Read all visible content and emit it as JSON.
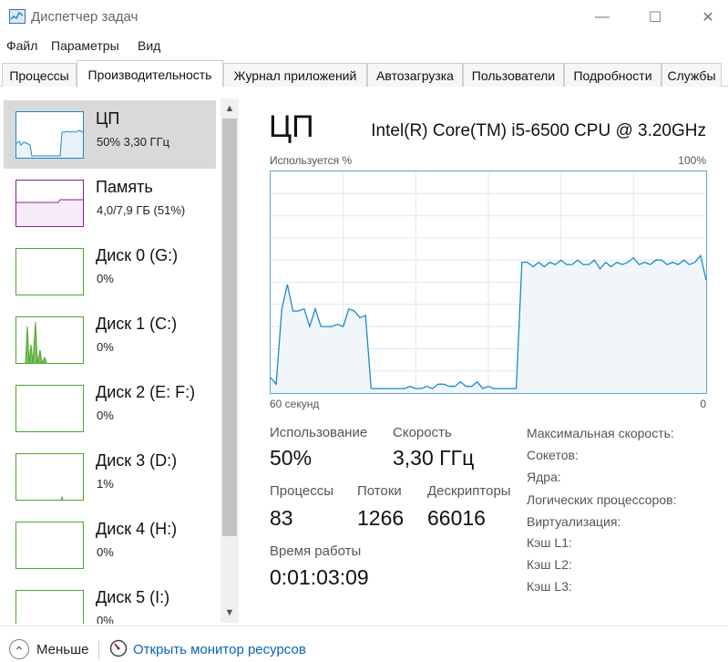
{
  "window": {
    "title": "Диспетчер задач",
    "minimize_glyph": "—",
    "maximize_glyph": "☐",
    "close_glyph": "✕"
  },
  "menu": [
    "Файл",
    "Параметры",
    "Вид"
  ],
  "tabs": [
    "Процессы",
    "Производительность",
    "Журнал приложений",
    "Автозагрузка",
    "Пользователи",
    "Подробности",
    "Службы"
  ],
  "active_tab": "Производительность",
  "sidebar": {
    "items": [
      {
        "title": "ЦП",
        "subtitle": "50% 3,30 ГГц",
        "color": "#1b8ac7"
      },
      {
        "title": "Память",
        "subtitle": "4,0/7,9 ГБ (51%)",
        "color": "#8b1f9c"
      },
      {
        "title": "Диск 0 (G:)",
        "subtitle": "0%",
        "color": "#4ca72f"
      },
      {
        "title": "Диск 1 (C:)",
        "subtitle": "0%",
        "color": "#4ca72f"
      },
      {
        "title": "Диск 2 (E: F:)",
        "subtitle": "0%",
        "color": "#4ca72f"
      },
      {
        "title": "Диск 3 (D:)",
        "subtitle": "1%",
        "color": "#4ca72f"
      },
      {
        "title": "Диск 4 (H:)",
        "subtitle": "0%",
        "color": "#4ca72f"
      },
      {
        "title": "Диск 5 (I:)",
        "subtitle": "0%",
        "color": "#4ca72f"
      }
    ],
    "scroll_up": "▲",
    "scroll_down": "▼"
  },
  "cpu": {
    "title": "ЦП",
    "name": "Intel(R) Core(TM) i5-6500 CPU @ 3.20GHz",
    "graph_label": "Используется %",
    "graph_max": "100%",
    "axis_left": "60 секунд",
    "axis_right": "0",
    "stats": {
      "usage_label": "Использование",
      "usage_value": "50%",
      "speed_label": "Скорость",
      "speed_value": "3,30 ГГц",
      "processes_label": "Процессы",
      "processes_value": "83",
      "threads_label": "Потоки",
      "threads_value": "1266",
      "handles_label": "Дескрипторы",
      "handles_value": "66016",
      "uptime_label": "Время работы",
      "uptime_value": "0:01:03:09"
    },
    "specs": [
      "Максимальная скорость:",
      "Сокетов:",
      "Ядра:",
      "Логических процессоров:",
      "Виртуализация:",
      "Кэш L1:",
      "Кэш L2:",
      "Кэш L3:"
    ]
  },
  "chart_data": {
    "type": "area",
    "ylim": [
      0,
      100
    ],
    "grid": true,
    "values": [
      7,
      4,
      38,
      49,
      37,
      37,
      38,
      30,
      38,
      30,
      30,
      30,
      31,
      30,
      38,
      37,
      34,
      35,
      2,
      2,
      2,
      2,
      2,
      2,
      2,
      3,
      2,
      2,
      3,
      2,
      4,
      4,
      3,
      3,
      5,
      3,
      3,
      5,
      2,
      3,
      2,
      2,
      2,
      2,
      2,
      59,
      59,
      57,
      59,
      57,
      59,
      58,
      60,
      58,
      58,
      60,
      58,
      58,
      60,
      56,
      59,
      57,
      59,
      58,
      59,
      61,
      58,
      59,
      58,
      60,
      60,
      58,
      59,
      58,
      60,
      58,
      59,
      62,
      51
    ]
  },
  "footer": {
    "fewer_label": "Меньше",
    "fewer_glyph": "⌃",
    "resmon_label": "Открыть монитор ресурсов"
  }
}
